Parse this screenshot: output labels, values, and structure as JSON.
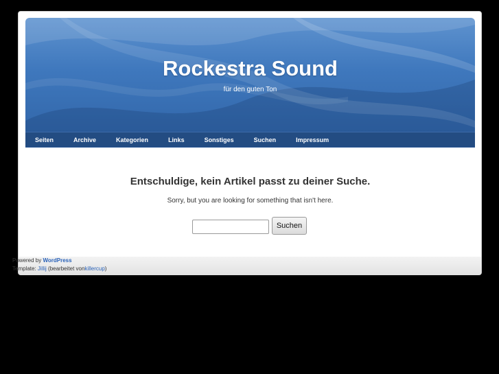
{
  "header": {
    "title": "Rockestra Sound",
    "tagline": "für den guten Ton"
  },
  "nav": {
    "items": [
      "Seiten",
      "Archive",
      "Kategorien",
      "Links",
      "Sonstiges",
      "Suchen",
      "Impressum"
    ]
  },
  "content": {
    "heading": "Entschuldige, kein Artikel passt zu deiner Suche.",
    "message": "Sorry, but you are looking for something that isn't here.",
    "search": {
      "value": "",
      "button_label": "Suchen"
    }
  },
  "footer": {
    "powered_prefix": "Powered by",
    "powered_link": "WordPress",
    "template_prefix": "Template:",
    "template_link": "Jillij",
    "edited_prefix": "(bearbeitet von",
    "edited_link": "killercup",
    "edited_suffix": ")"
  },
  "colors": {
    "background": "#000000",
    "header_blue": "#3f78bd",
    "nav_blue": "#234c82",
    "link_blue": "#2a62b8"
  }
}
